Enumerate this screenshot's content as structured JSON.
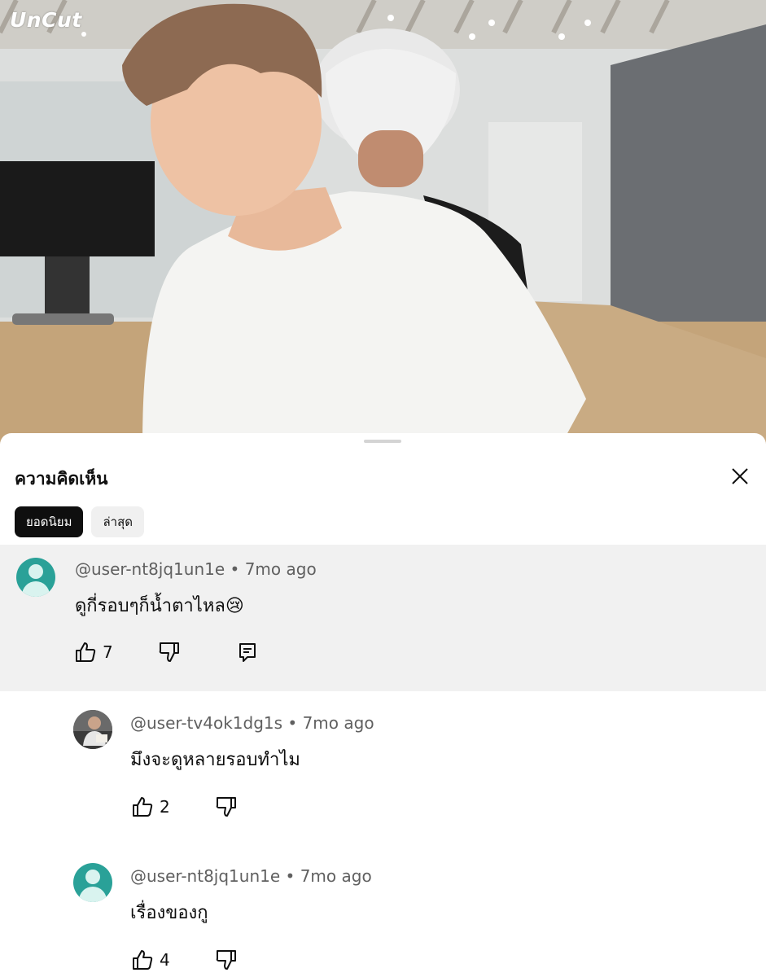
{
  "video": {
    "watermark": "UnCut"
  },
  "comments_panel": {
    "title": "ความคิดเห็น",
    "close_icon": "close-icon",
    "sort_chips": [
      {
        "label": "ยอดนิยม",
        "selected": true
      },
      {
        "label": "ล่าสุด",
        "selected": false
      }
    ],
    "thread": {
      "top_comment": {
        "author": "@user-nt8jq1un1e",
        "age": "7mo ago",
        "separator": "•",
        "text": "ดูกี่รอบๆก็น้ำตาไหล😢",
        "likes": "7",
        "avatar": "default-teal-avatar"
      },
      "replies": [
        {
          "author": "@user-tv4ok1dg1s",
          "age": "7mo ago",
          "separator": "•",
          "text": "มึงจะดูหลายรอบทำไม",
          "likes": "2",
          "avatar": "photo-avatar"
        },
        {
          "author": "@user-nt8jq1un1e",
          "age": "7mo ago",
          "separator": "•",
          "text": "เรื่องของกู",
          "likes": "4",
          "avatar": "default-teal-avatar"
        }
      ]
    }
  },
  "colors": {
    "highlight_bg": "#f1f1f1",
    "chip_active_bg": "#0f0f0f",
    "chip_inactive_bg": "#f0f0f0",
    "avatar_teal": "#2aa198",
    "meta_text": "#606060"
  }
}
